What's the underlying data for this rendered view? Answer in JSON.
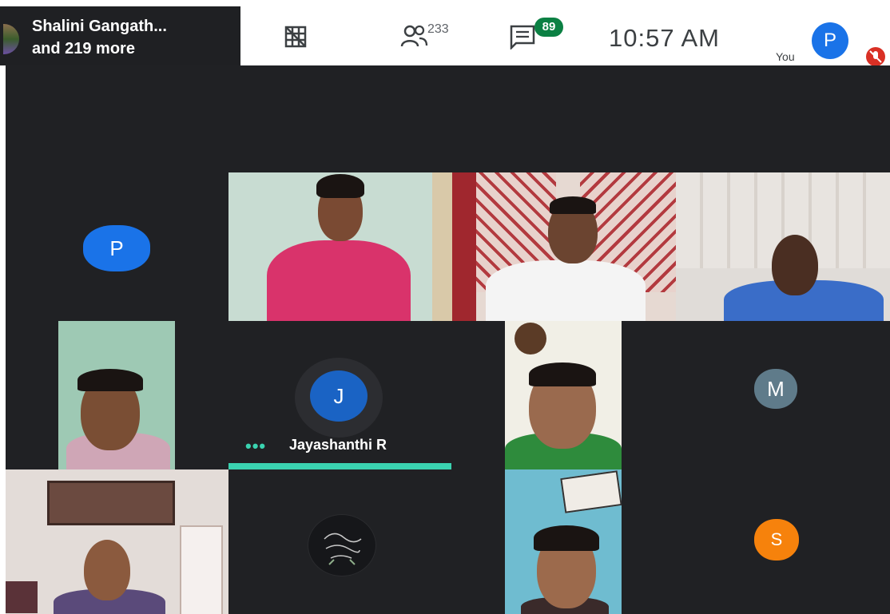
{
  "speaker": {
    "line1": "Shalini Gangath...",
    "line2": "and 219 more"
  },
  "toolbar": {
    "layout_icon": "tile-layout-icon",
    "people_icon": "people-icon",
    "people_count": "233",
    "chat_icon": "chat-icon",
    "chat_badge": "89",
    "time": "10:57 AM",
    "you_label": "You",
    "you_initial": "P",
    "mic_icon": "mic-off-icon"
  },
  "colors": {
    "stage_bg": "#202124",
    "accent_teal": "#3ad3b0",
    "avatar_blue": "#1a73e8",
    "avatar_gray": "#5f7b8a",
    "avatar_orange": "#f6820c",
    "badge_green": "#0b8043"
  },
  "participants": [
    {
      "initial": "P"
    },
    {
      "initial": "J",
      "name": "Jayashanthi R"
    },
    {
      "initial": "M"
    },
    {
      "initial": "S"
    }
  ]
}
